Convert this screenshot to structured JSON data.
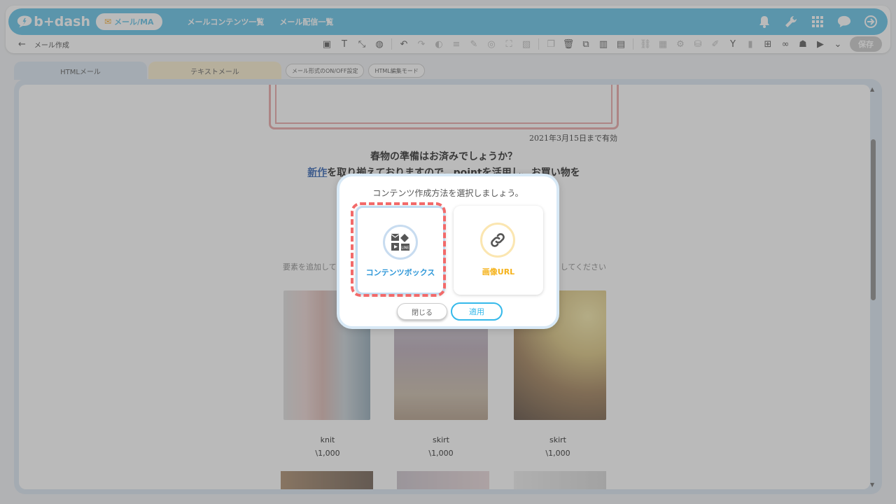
{
  "app": {
    "logo_text": "b+dash"
  },
  "topnav": {
    "active_pill": "メール/MA",
    "links": [
      "メールコンテンツ一覧",
      "メール配信一覧"
    ]
  },
  "subbar": {
    "back": "←",
    "title": "メール作成",
    "save": "保存"
  },
  "tabs": {
    "html": "HTMLメール",
    "text": "テキストメール",
    "onoff": "メール形式のON/OFF設定",
    "html_edit": "HTML編集モード"
  },
  "mail": {
    "expire": "2021年3月15日まで有効",
    "headline_line1": "春物の準備はお済みでしょうか？",
    "headline_link": "新作",
    "headline_line2": "を取り揃えておりますので、pointを活用し、お買い物を",
    "hint_left": "要素を追加して",
    "hint_right": "してください",
    "products": [
      {
        "name": "knit",
        "price": "\\1,000"
      },
      {
        "name": "skirt",
        "price": "\\1,000"
      },
      {
        "name": "skirt",
        "price": "\\1,000"
      }
    ]
  },
  "modal": {
    "title": "コンテンツ作成方法を選択しましょう。",
    "option_a": "コンテンツボックス",
    "option_b": "画像URL",
    "close": "閉じる",
    "apply": "適用"
  },
  "colors": {
    "accent": "#5cbfe6",
    "highlight": "#f26a6a",
    "apply": "#35b9ea",
    "url_option": "#f5b21a"
  }
}
